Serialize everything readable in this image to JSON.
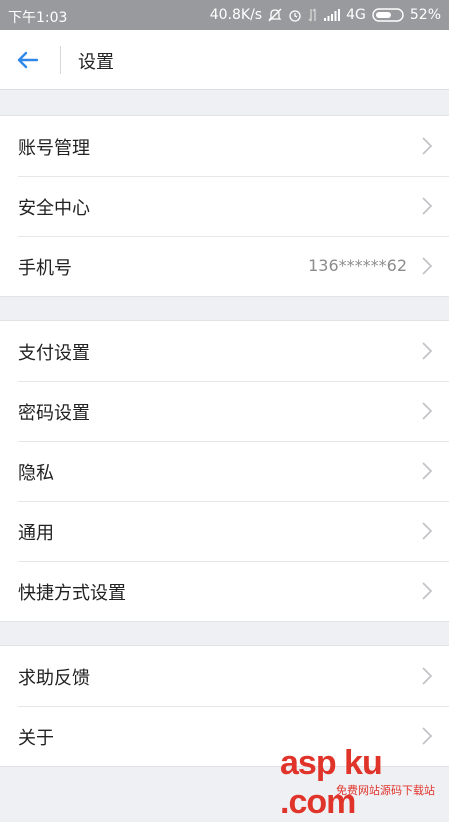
{
  "status_bar": {
    "time": "下午1:03",
    "speed": "40.8K/s",
    "network": "4G",
    "battery": "52%"
  },
  "header": {
    "title": "设置",
    "back_icon": "arrow-left-icon"
  },
  "groups": [
    {
      "items": [
        {
          "label": "账号管理",
          "value": ""
        },
        {
          "label": "安全中心",
          "value": ""
        },
        {
          "label": "手机号",
          "value": "136******62"
        }
      ]
    },
    {
      "items": [
        {
          "label": "支付设置",
          "value": ""
        },
        {
          "label": "密码设置",
          "value": ""
        },
        {
          "label": "隐私",
          "value": ""
        },
        {
          "label": "通用",
          "value": ""
        },
        {
          "label": "快捷方式设置",
          "value": ""
        }
      ]
    },
    {
      "items": [
        {
          "label": "求助反馈",
          "value": ""
        },
        {
          "label": "关于",
          "value": ""
        }
      ]
    }
  ],
  "watermark": {
    "text": "asp ku .com",
    "subtext": "免费网站源码下载站"
  },
  "colors": {
    "accent": "#2f88e8",
    "background": "#eff0f4",
    "status_bar": "#999a9d",
    "chevron": "#c4c4c8",
    "watermark": "#e0342a"
  }
}
